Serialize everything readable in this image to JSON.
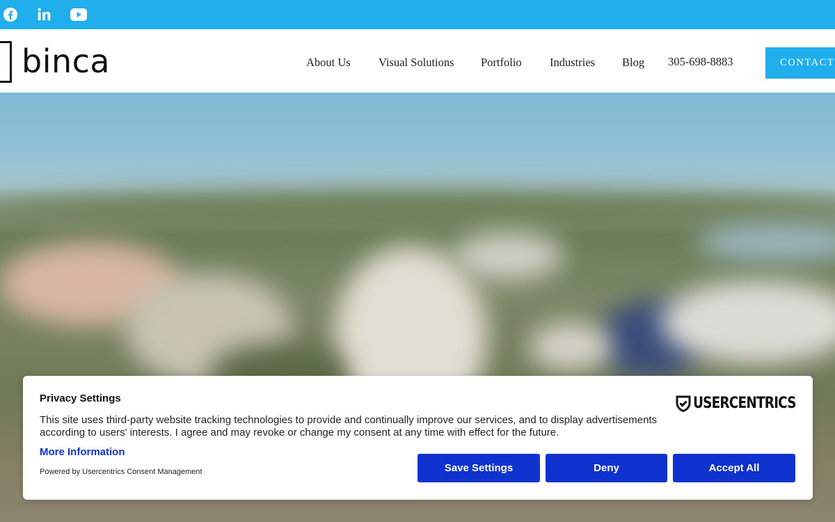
{
  "social": {
    "facebook_icon": "facebook-icon",
    "linkedin_icon": "linkedin-icon",
    "youtube_icon": "youtube-icon"
  },
  "header": {
    "logo_text": "binca",
    "nav": [
      "About Us",
      "Visual Solutions",
      "Portfolio",
      "Industries",
      "Blog"
    ],
    "phone": "305-698-8883",
    "contact_label": "CONTACT"
  },
  "consent": {
    "title": "Privacy Settings",
    "body": "This site uses third-party website tracking technologies to provide and continually improve our services, and to display advertisements according to users' interests. I agree and may revoke or change my consent at any time with effect for the future.",
    "more_info": "More Information",
    "powered_by": "Powered by Usercentrics Consent Management",
    "brand": "USERCENTRICS",
    "buttons": {
      "save": "Save Settings",
      "deny": "Deny",
      "accept": "Accept All"
    }
  },
  "colors": {
    "brand_blue": "#21aeec",
    "consent_button": "#1032cf",
    "link": "#1032cf"
  }
}
